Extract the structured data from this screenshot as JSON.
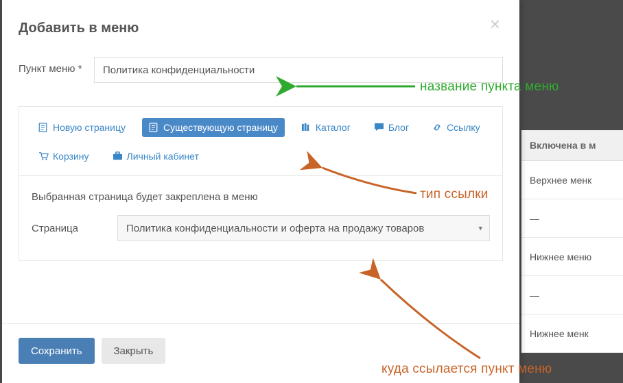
{
  "modal": {
    "title": "Добавить в меню",
    "field_label": "Пункт меню *",
    "field_value": "Политика конфиденциальности",
    "tabs": {
      "new_page": "Новую страницу",
      "existing_page": "Существующую страницу",
      "catalog": "Каталог",
      "blog": "Блог",
      "link": "Ссылку",
      "cart": "Корзину",
      "account": "Личный кабинет"
    },
    "pinned_text": "Выбранная страница будет закреплена в меню",
    "page_label": "Страница",
    "page_value": "Политика конфиденциальности и оферта на продажу товаров",
    "save": "Сохранить",
    "close": "Закрыть"
  },
  "annotations": {
    "name": "название пункта меню",
    "link_type": "тип ссылки",
    "target": "куда ссылается пункт меню"
  },
  "bg": {
    "header": "Включена в м",
    "rows": [
      "Верхнее менк",
      "—",
      "Нижнее меню",
      "—",
      "Нижнее менк"
    ]
  },
  "colors": {
    "primary": "#4a89c8",
    "green": "#2faa2f",
    "orange": "#c86428"
  }
}
